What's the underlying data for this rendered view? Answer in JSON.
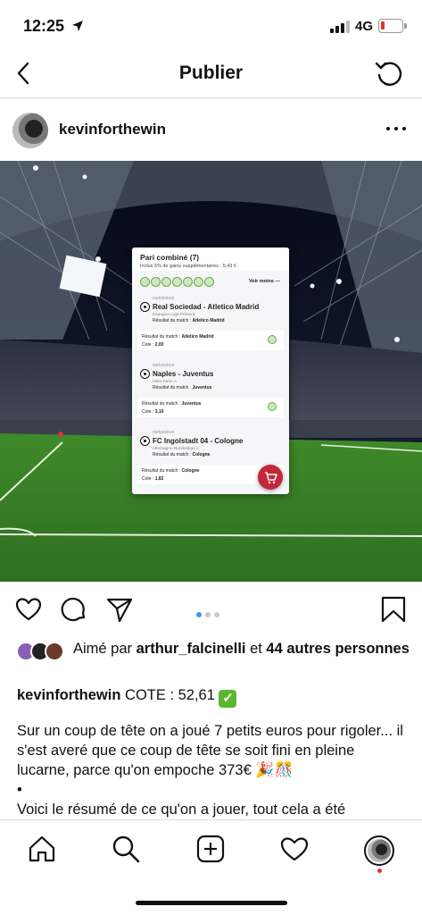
{
  "status_bar": {
    "time": "12:25",
    "location_icon": "location-arrow-icon",
    "network": "4G",
    "battery_color": "#e0342a"
  },
  "nav": {
    "title": "Publier",
    "back_icon": "chevron-left-icon",
    "refresh_icon": "refresh-icon"
  },
  "post": {
    "username": "kevinforthewin",
    "more_icon": "more-horizontal-icon"
  },
  "bet_slip": {
    "title": "Pari combiné (7)",
    "bonus": "Inclus 5% de gains supplémentaires : 5,43 €",
    "toggle": "Voir moins —",
    "matches": [
      {
        "date": "03/03/2019",
        "name": "Real Sociedad - Atletico Madrid",
        "league": "Espagne Liga Primera",
        "result_label": "Résultat du match : ",
        "result": "Atletico Madrid",
        "box_result_label": "Résultat du match : ",
        "box_result": "Atletico Madrid",
        "cote_label": "Cote : ",
        "cote": "2,00"
      },
      {
        "date": "03/03/2019",
        "name": "Naples - Juventus",
        "league": "Italie Serie A",
        "result_label": "Résultat du match : ",
        "result": "Juventus",
        "box_result_label": "Résultat du match : ",
        "box_result": "Juventus",
        "cote_label": "Cote : ",
        "cote": "3,10"
      },
      {
        "date": "03/03/2019",
        "name": "FC Ingolstadt 04 - Cologne",
        "league": "Allemagne Bundesliga 2",
        "result_label": "Résultat du match : ",
        "result": "Cologne",
        "box_result_label": "Résultat du match : ",
        "box_result": "Cologne",
        "cote_label": "Cote : ",
        "cote": "1,82"
      }
    ]
  },
  "carousel": {
    "count": 3,
    "active": 0,
    "active_color": "#3897f0"
  },
  "likes": {
    "prefix": "Aimé par ",
    "user": "arthur_falcinelli",
    "mid": " et ",
    "others": "44 autres personnes"
  },
  "caption": {
    "username": "kevinforthewin",
    "text": " COTE : 52,61 ",
    "emoji": "✓"
  },
  "body": {
    "paragraph1": "Sur un coup de tête on a joué 7 petits euros pour rigoler... il s'est averé que ce coup de tête se soit fini en pleine lucarne, parce qu'on empoche 373€ ",
    "emojis": "🎉🎊",
    "bullet": "•",
    "paragraph2": "Voici le résumé de ce qu'on a jouer, tout cela a été"
  },
  "tabs": [
    "home-icon",
    "search-icon",
    "add-post-icon",
    "activity-heart-icon",
    "profile-avatar"
  ]
}
